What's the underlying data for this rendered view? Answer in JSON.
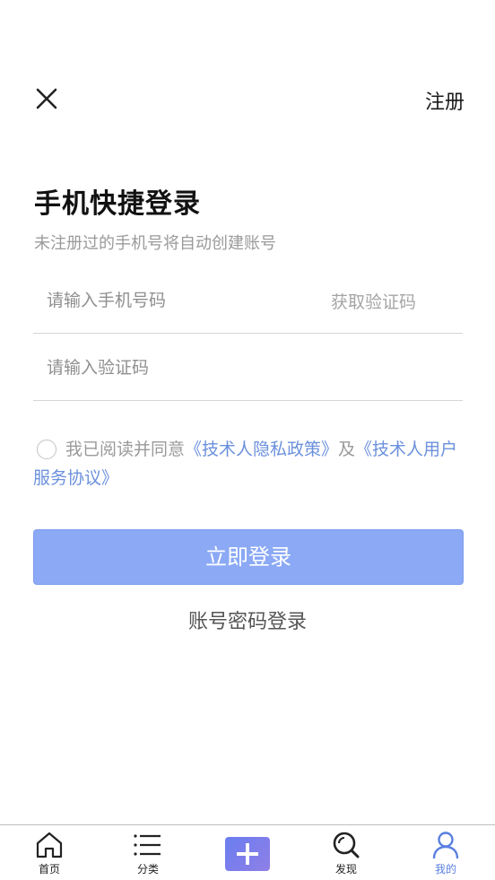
{
  "header": {
    "close_icon": "close-icon",
    "register_label": "注册"
  },
  "login": {
    "title": "手机快捷登录",
    "subtitle": "未注册过的手机号将自动创建账号",
    "phone_placeholder": "请输入手机号码",
    "get_code_label": "获取验证码",
    "code_placeholder": "请输入验证码",
    "agreement": {
      "prefix": "我已阅读并同意",
      "privacy_link": "《技术人隐私政策》",
      "conjunction": "及",
      "terms_link": "《技术人用户服务协议》"
    },
    "submit_label": "立即登录",
    "password_login_label": "账号密码登录"
  },
  "tabbar": {
    "items": [
      {
        "label": "首页",
        "icon": "home-icon"
      },
      {
        "label": "分类",
        "icon": "list-icon"
      },
      {
        "label": "",
        "icon": "plus-icon"
      },
      {
        "label": "发现",
        "icon": "search-icon"
      },
      {
        "label": "我的",
        "icon": "user-icon"
      }
    ],
    "active_index": 4
  },
  "colors": {
    "accent": "#8ba9f5",
    "link": "#6b90dc",
    "active_tab": "#5a7fe0"
  }
}
